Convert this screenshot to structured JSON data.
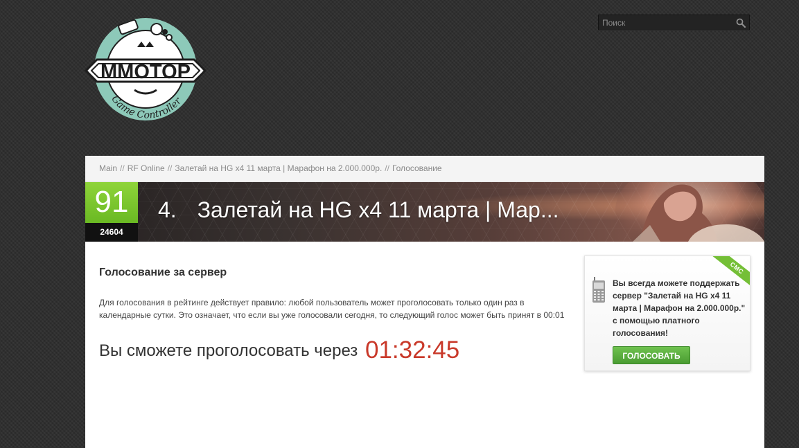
{
  "logo": {
    "name": "MMOTOP",
    "tagline": "Game Controller"
  },
  "search": {
    "placeholder": "Поиск",
    "icon": "magnifier-icon"
  },
  "breadcrumb": {
    "items": [
      "Main",
      "RF Online",
      "Залетай на HG x4 11 марта | Марафон на 2.000.000р.",
      "Голосование"
    ],
    "separator": "//"
  },
  "server": {
    "rating": "91",
    "votes": "24604",
    "rank": "4.",
    "title": "Залетай на HG x4 11 марта | Мар..."
  },
  "vote": {
    "heading": "Голосование за сервер",
    "rule": "Для голосования в рейтинге действует правило: любой пользователь может проголосовать только один раз в календарные сутки. Это означает, что если вы уже голосовали сегодня, то следующий голос может быть принят в 00:01",
    "wait_text": "Вы сможете проголосовать через",
    "countdown": "01:32:45"
  },
  "sms": {
    "ribbon": "СМС",
    "text": "Вы всегда можете поддержать сервер \"Залетай на HG x4 11 марта | Марафон на 2.000.000р.\" с помощью платного голосования!",
    "button": "ГОЛОСОВАТЬ"
  },
  "colors": {
    "accent_green": "#74bf36",
    "countdown_red": "#c9392a",
    "logo_teal": "#8dc9b9"
  }
}
